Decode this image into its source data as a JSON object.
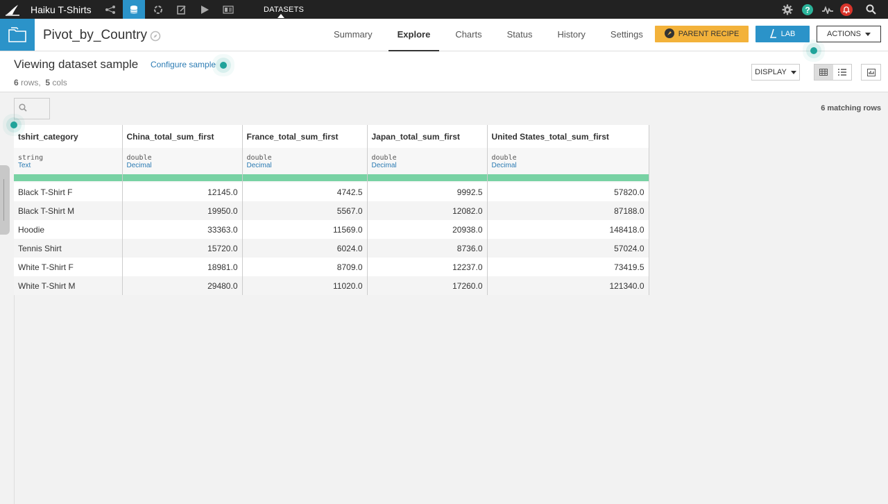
{
  "topbar": {
    "project_name": "Haiku T-Shirts",
    "section_label": "DATASETS",
    "nav_icons": [
      "flow-icon",
      "datasets-icon",
      "recipes-icon",
      "notebooks-icon",
      "jobs-icon",
      "dashboards-icon"
    ],
    "right_icons": [
      "settings-icon",
      "help-icon",
      "activity-icon",
      "notifications-icon",
      "search-icon"
    ]
  },
  "header": {
    "dataset_name": "Pivot_by_Country",
    "tabs": [
      {
        "label": "Summary",
        "active": false
      },
      {
        "label": "Explore",
        "active": true
      },
      {
        "label": "Charts",
        "active": false
      },
      {
        "label": "Status",
        "active": false
      },
      {
        "label": "History",
        "active": false
      },
      {
        "label": "Settings",
        "active": false
      }
    ],
    "parent_recipe_label": "PARENT RECIPE",
    "lab_label": "LAB",
    "actions_label": "ACTIONS"
  },
  "sample": {
    "title": "Viewing dataset sample",
    "configure_label": "Configure sample",
    "rows_count": "6",
    "rows_label": "rows,",
    "cols_count": "5",
    "cols_label": "cols",
    "display_label": "DISPLAY"
  },
  "grid": {
    "matching_rows": "6 matching rows",
    "columns": [
      {
        "name": "tshirt_category",
        "storage": "string",
        "meaning": "Text"
      },
      {
        "name": "China_total_sum_first",
        "storage": "double",
        "meaning": "Decimal"
      },
      {
        "name": "France_total_sum_first",
        "storage": "double",
        "meaning": "Decimal"
      },
      {
        "name": "Japan_total_sum_first",
        "storage": "double",
        "meaning": "Decimal"
      },
      {
        "name": "United States_total_sum_first",
        "storage": "double",
        "meaning": "Decimal"
      }
    ],
    "rows": [
      [
        "Black T-Shirt F",
        "12145.0",
        "4742.5",
        "9992.5",
        "57820.0"
      ],
      [
        "Black T-Shirt M",
        "19950.0",
        "5567.0",
        "12082.0",
        "87188.0"
      ],
      [
        "Hoodie",
        "33363.0",
        "11569.0",
        "20938.0",
        "148418.0"
      ],
      [
        "Tennis Shirt",
        "15720.0",
        "6024.0",
        "8736.0",
        "57024.0"
      ],
      [
        "White T-Shirt F",
        "18981.0",
        "8709.0",
        "12237.0",
        "73419.5"
      ],
      [
        "White T-Shirt M",
        "29480.0",
        "11020.0",
        "17260.0",
        "121340.0"
      ]
    ]
  },
  "colors": {
    "accent": "#2b93c9",
    "parent_recipe": "#f3b23a",
    "validity_bar": "#78d2a4",
    "tour_dot": "#20a39a"
  }
}
